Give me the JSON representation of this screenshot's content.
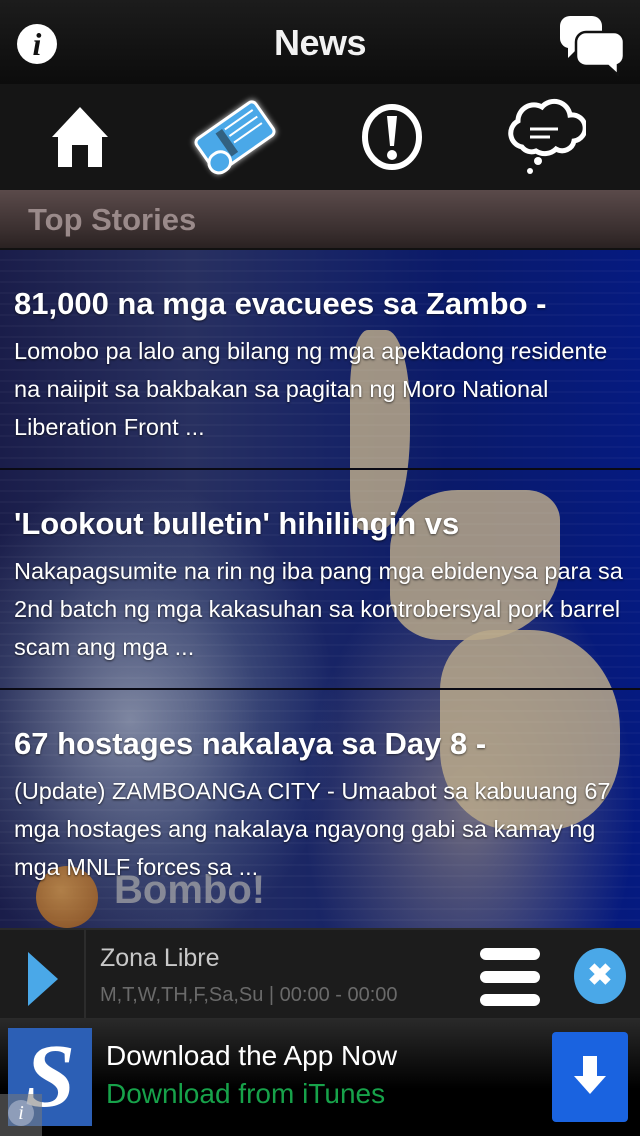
{
  "header": {
    "title": "News",
    "left_icon": "info-icon",
    "right_icon": "chat-bubbles-icon"
  },
  "nav": {
    "items": [
      {
        "id": "home",
        "icon": "home-icon",
        "active": false
      },
      {
        "id": "news",
        "icon": "newspaper-icon",
        "active": true
      },
      {
        "id": "alerts",
        "icon": "exclamation-icon",
        "active": false
      },
      {
        "id": "comments",
        "icon": "thought-cloud-icon",
        "active": false
      }
    ],
    "accent_color": "#4aa8e8"
  },
  "section": {
    "title": "Top Stories"
  },
  "stories": [
    {
      "headline": "81,000 na mga evacuees sa Zambo -",
      "summary": "Lomobo pa lalo ang bilang ng mga apektadong residente na naiipit sa bakbakan sa pagitan ng Moro National Liberation Front ..."
    },
    {
      "headline": "'Lookout bulletin' hihilingin vs",
      "summary": "Nakapagsumite na rin ng iba pang mga ebidenysa para sa 2nd batch ng mga kakasuhan sa kontrobersyal pork barrel scam ang mga ..."
    },
    {
      "headline": "67 hostages nakalaya sa Day 8 -",
      "summary": "(Update) ZAMBOANGA CITY - Umaabot sa kabuuang 67 mga hostages ang nakalaya ngayong gabi sa kamay ng mga MNLF forces sa ..."
    }
  ],
  "background_logo": "Bombo!",
  "player": {
    "show": "Zona Libre",
    "schedule": "M,T,W,TH,F,Sa,Su | 00:00 - 00:00",
    "play_icon": "play-icon",
    "menu_icon": "menu-icon",
    "close_icon": "close-icon",
    "close_glyph": "✖"
  },
  "ad": {
    "logo_letter": "S",
    "line1": "Download the App Now",
    "line2": "Download from iTunes",
    "info_glyph": "i",
    "download_icon": "download-arrow-icon",
    "line2_color": "#17a24a",
    "button_color": "#1a63e0"
  }
}
